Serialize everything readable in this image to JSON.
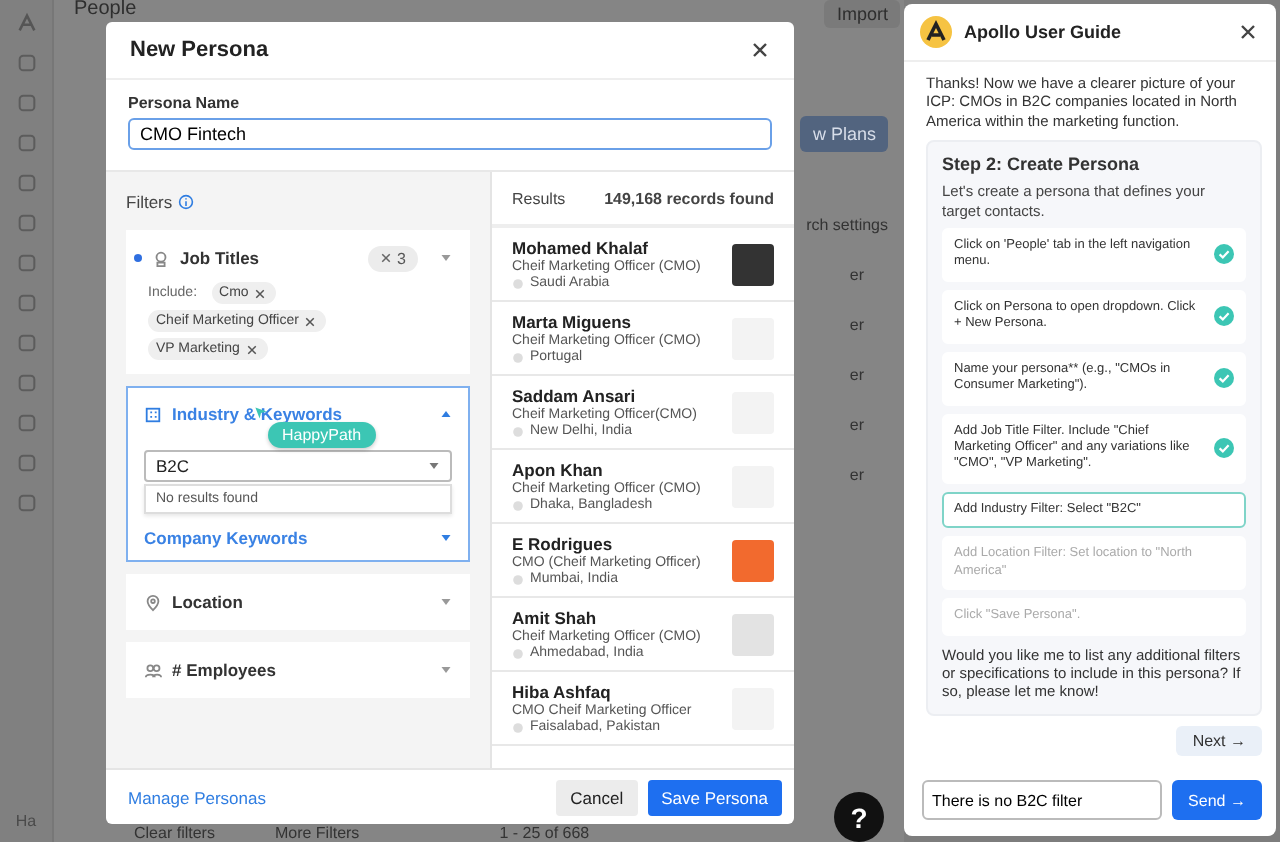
{
  "background": {
    "title": "People",
    "import_button": "Import",
    "plans_button": "w Plans",
    "search_settings": "rch settings",
    "column_fragments": [
      "er",
      "er",
      "er",
      "er",
      "er"
    ],
    "clear_filters": "Clear filters",
    "more_filters": "More Filters",
    "pagination": "1 - 25 of 668",
    "user_initials": "Ha"
  },
  "modal": {
    "title": "New Persona",
    "name_label": "Persona Name",
    "name_value": "CMO Fintech",
    "filters_label": "Filters",
    "filters": [
      {
        "kind": "tags",
        "label": "Job Titles",
        "active": true,
        "count": "3",
        "include_label": "Include:",
        "tags": [
          "Cmo",
          "Cheif Marketing Officer",
          "VP Marketing"
        ],
        "expanded": false
      },
      {
        "kind": "search",
        "label": "Industry & Keywords",
        "active": false,
        "expanded": true,
        "value": "B2C",
        "dropdown_message": "No results found",
        "sub_label": "Company Keywords"
      },
      {
        "kind": "plain",
        "label": "Location",
        "active": false,
        "expanded": false
      },
      {
        "kind": "plain",
        "label": "# Employees",
        "active": false,
        "expanded": false
      }
    ],
    "cursor_label": "HappyPath",
    "results_label": "Results",
    "results_count": "149,168 records found",
    "results": [
      {
        "name": "Mohamed Khalaf",
        "title": "Cheif Marketing Officer (CMO)",
        "location": "Saudi Arabia",
        "color": "#333333"
      },
      {
        "name": "Marta Miguens",
        "title": "Cheif Marketing Officer (CMO)",
        "location": "Portugal",
        "color": "#f3f3f3"
      },
      {
        "name": "Saddam Ansari",
        "title": "Cheif Marketing Officer(CMO)",
        "location": "New Delhi, India",
        "color": "#f3f3f3"
      },
      {
        "name": "Apon Khan",
        "title": "Cheif Marketing Officer (CMO)",
        "location": "Dhaka, Bangladesh",
        "color": "#f3f3f3"
      },
      {
        "name": "E Rodrigues",
        "title": "CMO (Cheif Marketing Officer)",
        "location": "Mumbai, India",
        "color": "#f26a2e"
      },
      {
        "name": "Amit Shah",
        "title": "Cheif Marketing Officer (CMO)",
        "location": "Ahmedabad, India",
        "color": "#e3e3e3"
      },
      {
        "name": "Hiba Ashfaq",
        "title": "CMO Cheif Marketing Officer",
        "location": "Faisalabad, Pakistan",
        "color": "#f3f3f3"
      }
    ],
    "manage_link": "Manage Personas",
    "cancel_button": "Cancel",
    "save_button": "Save Persona"
  },
  "help_button": "?",
  "guide": {
    "title": "Apollo User Guide",
    "intro": "Thanks! Now we have a clearer picture of your ICP: CMOs in B2C companies located in North America within the marketing function.",
    "step_title": "Step 2: Create Persona",
    "step_description": "Let's create a persona that defines your target contacts.",
    "steps": [
      {
        "text": "Click on 'People' tab in the left navigation menu.",
        "done": true,
        "active": false
      },
      {
        "text": "Click on Persona to open dropdown. Click + New Persona.",
        "done": true,
        "active": false
      },
      {
        "text": "Name your persona** (e.g., \"CMOs in Consumer Marketing\").",
        "done": true,
        "active": false
      },
      {
        "text": "Add Job Title Filter. Include \"Chief Marketing Officer\" and any variations like \"CMO\", \"VP Marketing\".",
        "done": true,
        "active": false
      },
      {
        "text": "Add Industry Filter: Select \"B2C\"",
        "done": false,
        "active": true
      },
      {
        "text": "Add Location Filter: Set location to \"North America\"",
        "done": false,
        "active": false
      },
      {
        "text": "Click \"Save Persona\".",
        "done": false,
        "active": false
      }
    ],
    "closing": "Would you like me to list any additional filters or specifications to include in this persona? If so, please let me know!",
    "next_button": "Next →",
    "input_value": "There is no B2C filter",
    "send_button": "Send →"
  }
}
